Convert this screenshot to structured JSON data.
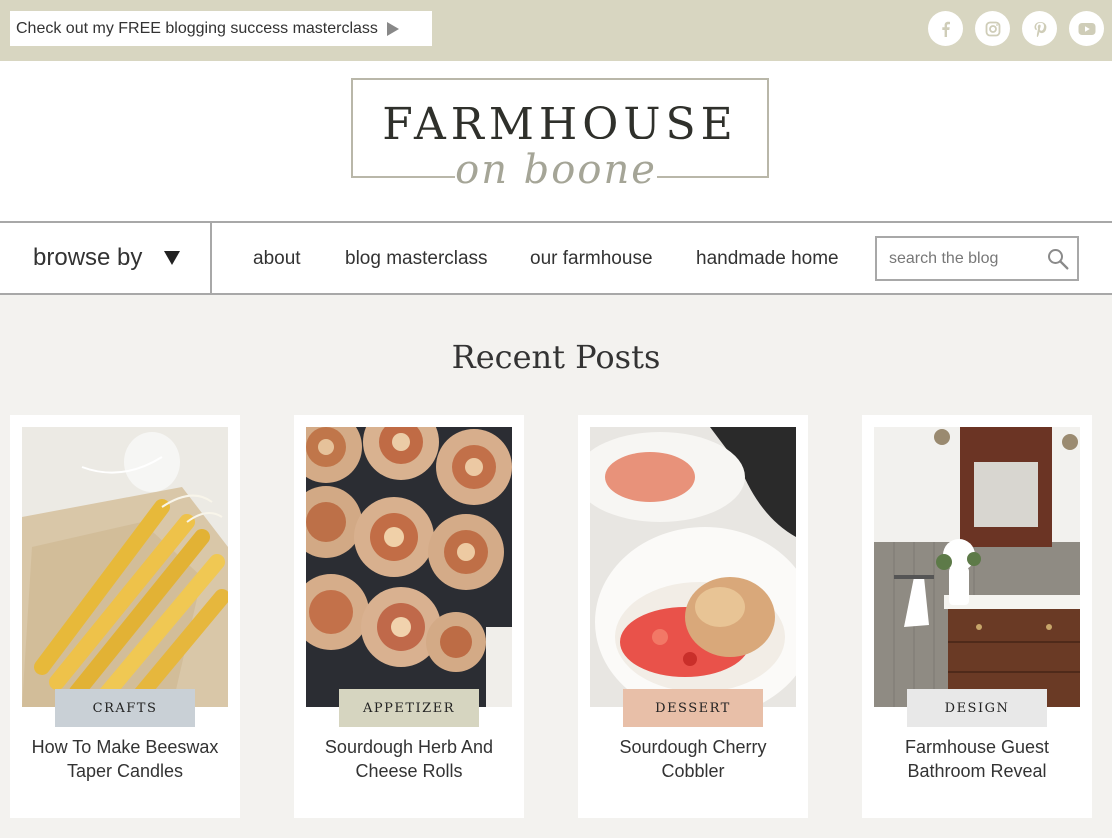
{
  "topbar": {
    "promo_text": "Check out my FREE blogging success masterclass",
    "social": [
      {
        "name": "facebook-icon"
      },
      {
        "name": "instagram-icon"
      },
      {
        "name": "pinterest-icon"
      },
      {
        "name": "youtube-icon"
      }
    ],
    "bg_color": "#d8d6c1"
  },
  "logo": {
    "main": "FARMHOUSE",
    "sub": "on boone"
  },
  "nav": {
    "browse_label": "browse by",
    "links": [
      "about",
      "blog masterclass",
      "our farmhouse",
      "handmade home"
    ],
    "search_placeholder": "search the blog"
  },
  "section": {
    "title": "Recent Posts"
  },
  "posts": [
    {
      "category": "CRAFTS",
      "badge_color": "#c9d0d6",
      "title": "How To Make Beeswax Taper Candles"
    },
    {
      "category": "APPETIZER",
      "badge_color": "#d6d5c0",
      "title": "Sourdough Herb And Cheese Rolls"
    },
    {
      "category": "DESSERT",
      "badge_color": "#e8bfa8",
      "title": "Sourdough Cherry Cobbler"
    },
    {
      "category": "DESIGN",
      "badge_color": "#e8e8e8",
      "title": "Farmhouse Guest Bathroom Reveal"
    }
  ]
}
